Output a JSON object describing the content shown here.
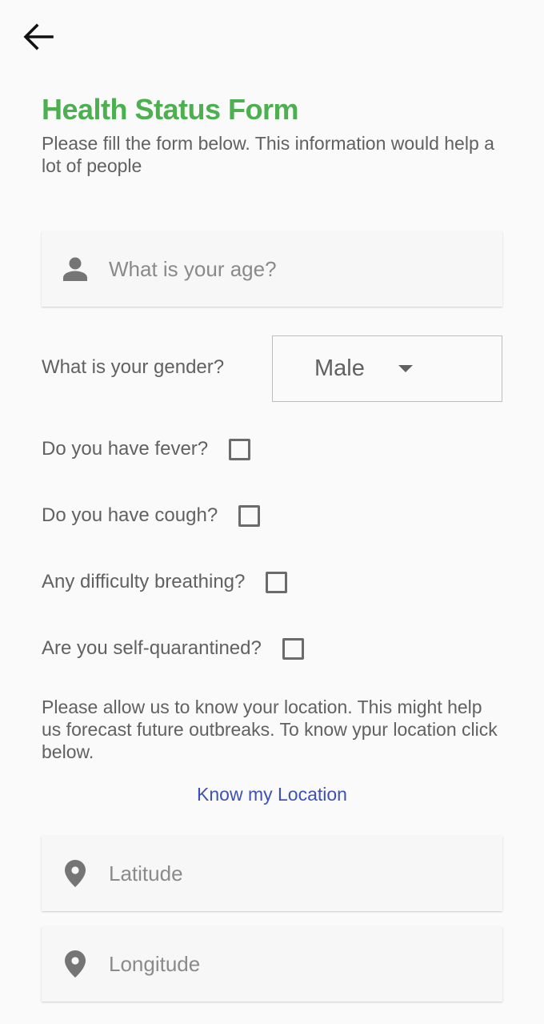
{
  "header": {
    "back_icon": "arrow-left-icon",
    "title": "Health Status Form",
    "subtitle": "Please fill the form below. This information would help a lot of people"
  },
  "age": {
    "icon": "person-icon",
    "placeholder": "What is your age?",
    "value": ""
  },
  "gender": {
    "label": "What is your gender?",
    "selected": "Male"
  },
  "questions": [
    {
      "label": "Do you have fever?",
      "checked": false
    },
    {
      "label": "Do you have cough?",
      "checked": false
    },
    {
      "label": "Any difficulty breathing?",
      "checked": false
    },
    {
      "label": "Are you self-quarantined?",
      "checked": false
    }
  ],
  "location": {
    "description": "Please allow us to know your location. This might help us forecast future outbreaks. To know ypur location click below.",
    "link_label": "Know my Location",
    "latitude_placeholder": "Latitude",
    "longitude_placeholder": "Longitude",
    "icon": "location-pin-icon"
  },
  "colors": {
    "title": "#4caf50",
    "link": "#3f51b5",
    "text": "#616161"
  }
}
